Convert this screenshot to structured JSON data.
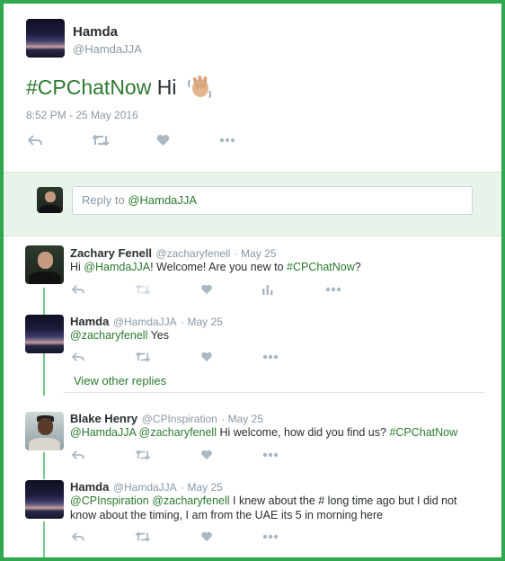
{
  "tweet": {
    "author_name": "Hamda",
    "author_handle": "@HamdaJJA",
    "hashtag": "#CPChatNow",
    "text_rest": " Hi",
    "timestamp": "8:52 PM - 25 May 2016"
  },
  "reply_box": {
    "prefix": "Reply to ",
    "mention": "@HamdaJJA"
  },
  "replies": [
    {
      "name": "Zachary Fenell",
      "handle": "@zacharyfenell",
      "date": "· May 25",
      "parts": [
        "Hi ",
        "@HamdaJJA",
        "! Welcome! Are you new to ",
        "#CPChatNow",
        "?"
      ]
    },
    {
      "name": "Hamda",
      "handle": "@HamdaJJA",
      "date": "· May 25",
      "parts": [
        "@zacharyfenell",
        " Yes"
      ]
    },
    {
      "name": "Blake Henry",
      "handle": "@CPInspiration",
      "date": "· May 25",
      "parts": [
        "@HamdaJJA",
        " ",
        "@zacharyfenell",
        " Hi welcome, how did you find us? ",
        "#CPChatNow"
      ]
    },
    {
      "name": "Hamda",
      "handle": "@HamdaJJA",
      "date": "· May 25",
      "parts": [
        "@CPInspiration",
        " ",
        "@zacharyfenell",
        " I knew about the # long time ago but I did not know about the timing, I am from the UAE its 5 in morning here"
      ]
    }
  ],
  "view_other_replies": "View other replies",
  "colors": {
    "link": "#2b7a2f",
    "border": "#2fa84f",
    "thread": "#7ac88c",
    "icon": "#aab8c2"
  },
  "icons": [
    "reply-icon",
    "retweet-icon",
    "like-icon",
    "more-icon",
    "analytics-icon",
    "waving-hand-icon"
  ]
}
